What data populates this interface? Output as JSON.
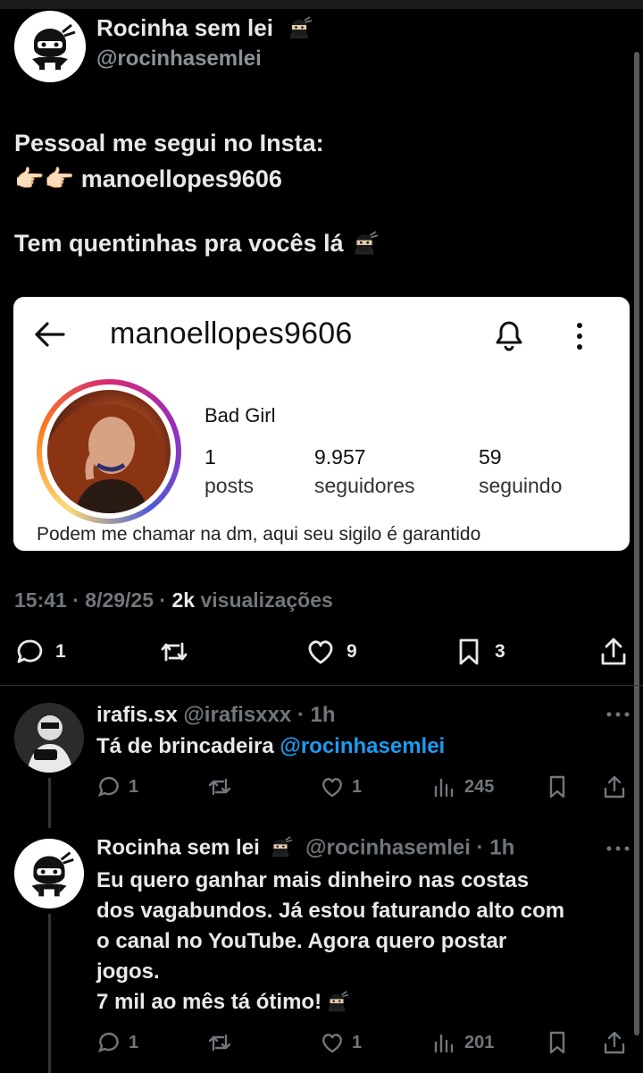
{
  "tweet": {
    "author_name": "Rocinha sem lei",
    "author_handle": "@rocinhasemlei",
    "text_line1": "Pessoal me segui no Insta:",
    "text_line2": "👉🏻👉🏻 manoellopes9606",
    "text_line3": "Tem quentinhas pra vocês lá",
    "time": "15:41",
    "date": "8/29/25",
    "views_count": "2k",
    "views_label": "visualizações",
    "replies": "1",
    "likes": "9",
    "bookmarks": "3"
  },
  "instagram_card": {
    "username": "manoellopes9606",
    "display_name": "Bad Girl",
    "posts_count": "1",
    "posts_label": "posts",
    "followers_count": "9.957",
    "followers_label": "seguidores",
    "following_count": "59",
    "following_label": "seguindo",
    "bio": "Podem me chamar na dm, aqui seu sigilo é garantido"
  },
  "replies": [
    {
      "name": "irafis.sx",
      "handle": "@irafisxxx",
      "time": "1h",
      "text": "Tá de brincadeira",
      "mention": "@rocinhasemlei",
      "replies": "1",
      "likes": "1",
      "views": "245"
    },
    {
      "name": "Rocinha sem lei",
      "handle": "@rocinhasemlei",
      "time": "1h",
      "text_line1": "Eu quero ganhar mais dinheiro nas costas",
      "text_line2": "dos vagabundos. Já estou faturando alto com",
      "text_line3": "o canal no YouTube. Agora quero postar",
      "text_line4": "jogos.",
      "text_line5": "7 mil ao mês tá ótimo!",
      "replies": "1",
      "likes": "1",
      "views": "201"
    }
  ],
  "colors": {
    "background": "#000000",
    "text": "#e7e9ea",
    "muted": "#71767b",
    "link": "#1d9bf0"
  }
}
